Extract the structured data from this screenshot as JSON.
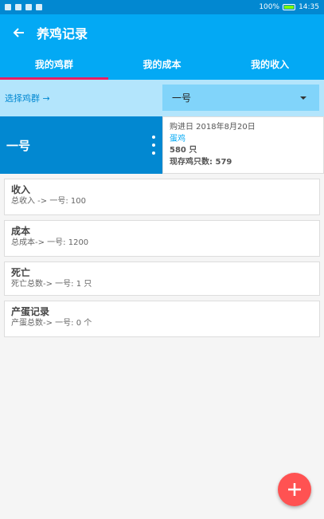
{
  "status_bar": {
    "battery": "100%",
    "time": "14:35"
  },
  "toolbar": {
    "title": "养鸡记录"
  },
  "tabs": [
    {
      "label": "我的鸡群",
      "active": true
    },
    {
      "label": "我的成本",
      "active": false
    },
    {
      "label": "我的收入",
      "active": false
    }
  ],
  "selector": {
    "label": "选择鸡群 →",
    "selected": "一号"
  },
  "flock": {
    "name": "一号",
    "purchase_date": "购进日 2018年8月20日",
    "breed": "蛋鸡",
    "purchased": "580 只",
    "current": "现存鸡只数: 579"
  },
  "cards": [
    {
      "title": "收入",
      "detail": "总收入 -> 一号: 100"
    },
    {
      "title": "成本",
      "detail": "总成本-> 一号: 1200"
    },
    {
      "title": "死亡",
      "detail": "死亡总数-> 一号: 1 只"
    },
    {
      "title": "产蛋记录",
      "detail": "产蛋总数-> 一号: 0 个"
    }
  ],
  "fab": {
    "icon": "plus-icon"
  },
  "colors": {
    "primary": "#03a9f4",
    "primary_dark": "#0288d1",
    "accent": "#ff5252",
    "tab_indicator": "#e91e63"
  }
}
